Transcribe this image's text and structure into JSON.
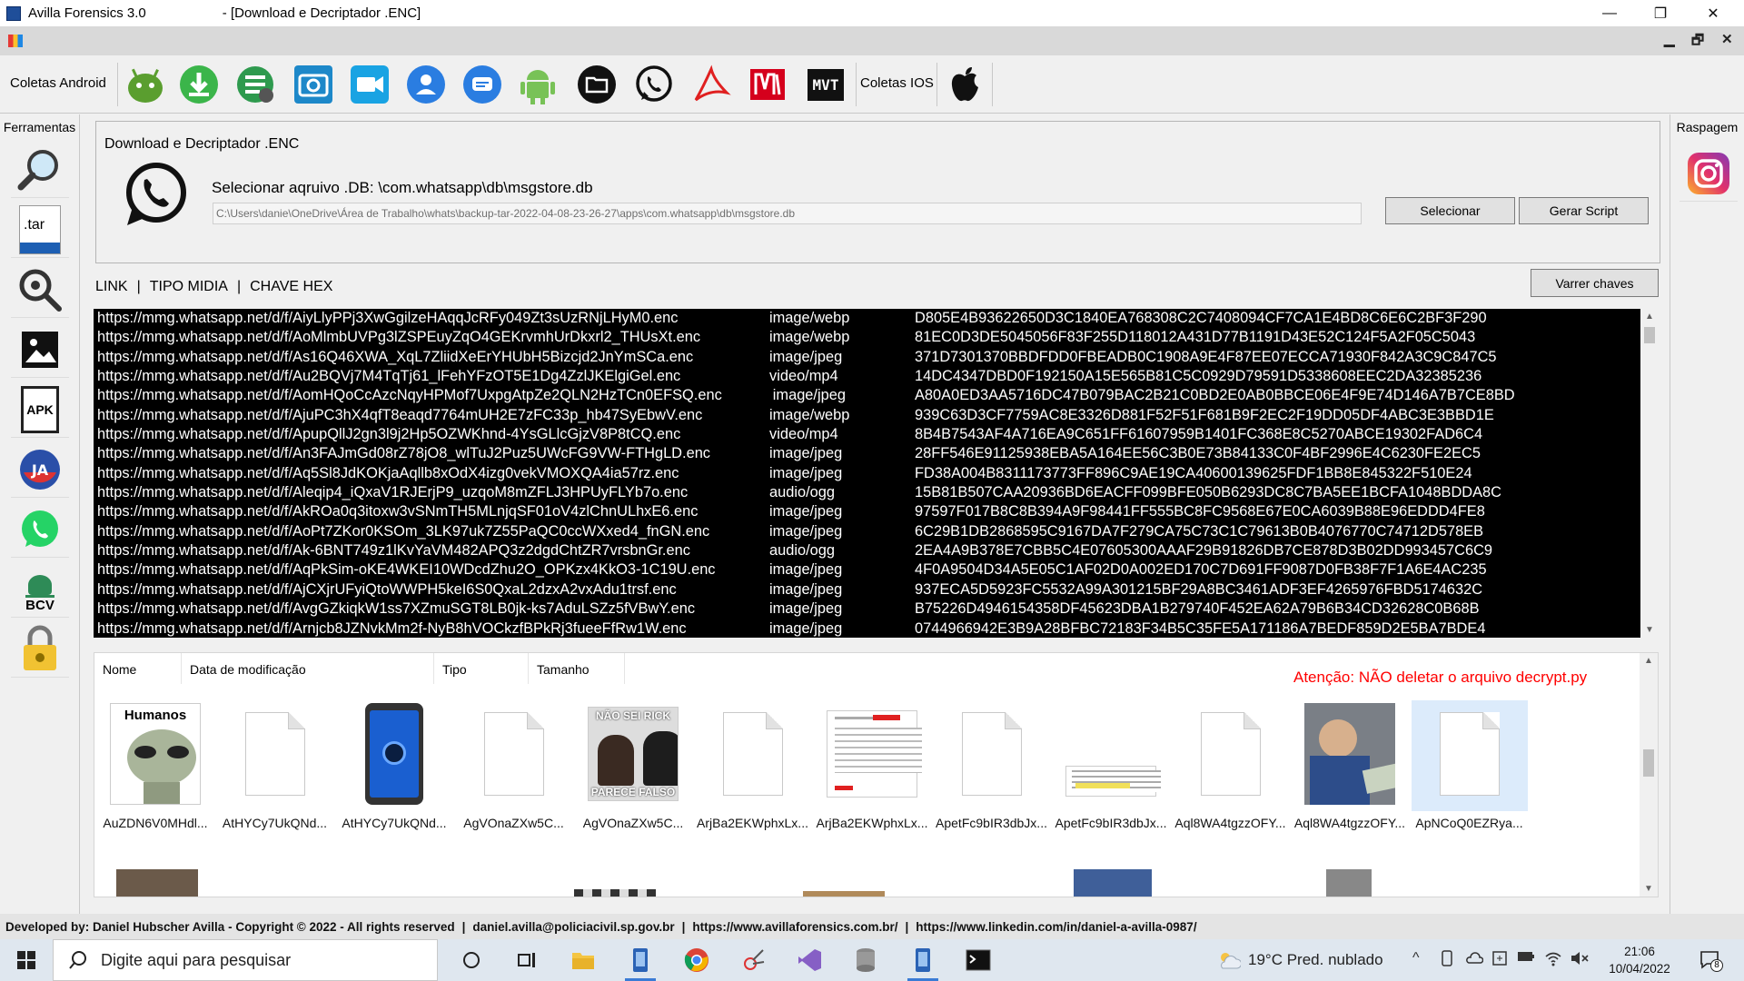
{
  "window": {
    "app_name": "Avilla Forensics 3.0",
    "doc_name": "- [Download e Decriptador .ENC]",
    "minimize_label": "—",
    "restore_label": "❐",
    "close_label": "✕",
    "mdi_minimize_label": "▁",
    "mdi_restore_label": "🗗",
    "mdi_close_label": "✕"
  },
  "toolbar": {
    "android_label": "Coletas Android",
    "ios_label": "Coletas IOS",
    "android_icons": [
      "android-head-icon",
      "download-icon",
      "sms-backup-icon",
      "camera-icon",
      "video-icon",
      "contacts-icon",
      "messages-icon",
      "android-robot-icon",
      "folder-black-icon",
      "whatsapp-icon",
      "pdf-icon",
      "m-logo-icon",
      "mvt-icon"
    ],
    "mvt_text": "MVT"
  },
  "sidebar_left": {
    "title": "Ferramentas",
    "tar_text": ".tar",
    "apk_text": "APK",
    "bcv_text": "BCV",
    "icons": [
      "magnifier-icon",
      "tar-file-icon",
      "gear-search-icon",
      "image-icon",
      "apk-icon",
      "jadx-icon",
      "whatsapp-icon",
      "bcv-icon",
      "hash-lock-icon"
    ]
  },
  "sidebar_right": {
    "title": "Raspagem",
    "icons": [
      "instagram-icon"
    ]
  },
  "panel": {
    "title": "Download e Decriptador .ENC",
    "db_label": "Selecionar aqruivo .DB: \\com.whatsapp\\db\\msgstore.db",
    "db_path": "C:\\Users\\danie\\OneDrive\\Área de Trabalho\\whats\\backup-tar-2022-04-08-23-26-27\\apps\\com.whatsapp\\db\\msgstore.db",
    "select_button": "Selecionar",
    "script_button": "Gerar Script",
    "keys_button": "Varrer chaves"
  },
  "columns": {
    "link": "LINK",
    "sep1": "|",
    "tipo": "TIPO MIDIA",
    "sep2": "|",
    "chave": "CHAVE HEX"
  },
  "terminal": {
    "rows": [
      {
        "url": "https://mmg.whatsapp.net/d/f/AiyLlyPPj3XwGgilzeHAqqJcRFy049Zt3sUzRNjLHyM0.enc",
        "type": "image/webp",
        "key": "D805E4B93622650D3C1840EA768308C2C7408094CF7CA1E4BD8C6E6C2BF3F290"
      },
      {
        "url": "https://mmg.whatsapp.net/d/f/AoMlmbUVPg3lZSPEuyZqO4GEKrvmhUrDkxrl2_THUsXt.enc",
        "type": "image/webp",
        "key": "81EC0D3DE5045056F83F255D118012A431D77B1191D43E52C124F5A2F05C5043"
      },
      {
        "url": "https://mmg.whatsapp.net/d/f/As16Q46XWA_XqL7ZliidXeErYHUbH5Bizcjd2JnYmSCa.enc",
        "type": "image/jpeg",
        "key": "371D7301370BBDFDD0FBEADB0C1908A9E4F87EE07ECCA71930F842A3C9C847C5"
      },
      {
        "url": "https://mmg.whatsapp.net/d/f/Au2BQVj7M4TqTj61_lFehYFzOT5E1Dg4ZzlJKElgiGel.enc",
        "type": "video/mp4",
        "key": "14DC4347DBD0F192150A15E565B81C5C0929D79591D5338608EEC2DA32385236"
      },
      {
        "url": "https://mmg.whatsapp.net/d/f/AomHQoCcAzcNqyHPMof7UxpgAtpZe2QLN2HzTCn0EFSQ.enc",
        "type": "image/jpeg",
        "key": "A80A0ED3AA5716DC47B079BAC2B21C0BD2E0AB0BBCE06E4F9E74D146A7B7CE8BD"
      },
      {
        "url": "https://mmg.whatsapp.net/d/f/AjuPC3hX4qfT8eaqd7764mUH2E7zFC33p_hb47SyEbwV.enc",
        "type": "image/webp",
        "key": "939C63D3CF7759AC8E3326D881F52F51F681B9F2EC2F19DD05DF4ABC3E3BBD1E"
      },
      {
        "url": "https://mmg.whatsapp.net/d/f/ApupQllJ2gn3l9j2Hp5OZWKhnd-4YsGLlcGjzV8P8tCQ.enc",
        "type": "video/mp4",
        "key": "8B4B7543AF4A716EA9C651FF61607959B1401FC368E8C5270ABCE19302FAD6C4"
      },
      {
        "url": "https://mmg.whatsapp.net/d/f/An3FAJmGd08rZ78jO8_wlTuJ2Puz5UWcFG9VW-FTHgLD.enc",
        "type": "image/jpeg",
        "key": "28FF546E91125938EBA5A164EE56C3B0E73B84133C0F4BF2996E4C6230FE2EC5"
      },
      {
        "url": "https://mmg.whatsapp.net/d/f/Aq5Sl8JdKOKjaAqllb8xOdX4izg0vekVMOXQA4ia57rz.enc",
        "type": "image/jpeg",
        "key": "FD38A004B8311173773FF896C9AE19CA40600139625FDF1BB8E845322F510E24"
      },
      {
        "url": "https://mmg.whatsapp.net/d/f/Aleqip4_iQxaV1RJErjP9_uzqoM8mZFLJ3HPUyFLYb7o.enc",
        "type": "audio/ogg",
        "key": "15B81B507CAA20936BD6EACFF099BFE050B6293DC8C7BA5EE1BCFA1048BDDA8C"
      },
      {
        "url": "https://mmg.whatsapp.net/d/f/AkROa0q3itoxw3vSNmTH5MLnjqSF01oV4zlChnULhxE6.enc",
        "type": "image/jpeg",
        "key": "97597F017B8C8B394A9F98441FF555BC8FC9568E67E0CA6039B88E96EDDD4FE8"
      },
      {
        "url": "https://mmg.whatsapp.net/d/f/AoPt7ZKor0KSOm_3LK97uk7Z55PaQC0ccWXxed4_fnGN.enc",
        "type": "image/jpeg",
        "key": "6C29B1DB2868595C9167DA7F279CA75C73C1C79613B0B4076770C74712D578EB"
      },
      {
        "url": "https://mmg.whatsapp.net/d/f/Ak-6BNT749z1lKvYaVM482APQ3z2dgdChtZR7vrsbnGr.enc",
        "type": "audio/ogg",
        "key": "2EA4A9B378E7CBB5C4E07605300AAAF29B91826DB7CE878D3B02DD993457C6C9"
      },
      {
        "url": "https://mmg.whatsapp.net/d/f/AqPkSim-oKE4WKEI10WDcdZhu2O_OPKzx4KkO3-1C19U.enc",
        "type": "image/jpeg",
        "key": "4F0A9504D34A5E05C1AF02D0A002ED170C7D691FF9087D0FB38F7F1A6E4AC235"
      },
      {
        "url": "https://mmg.whatsapp.net/d/f/AjCXjrUFyiQtoWWPH5keI6S0QxaL2dzxA2vxAdu1trsf.enc",
        "type": "image/jpeg",
        "key": "937ECA5D5923FC5532A99A301215BF29A8BC3461ADF3EF4265976FBD5174632C"
      },
      {
        "url": "https://mmg.whatsapp.net/d/f/AvgGZkiqkW1ss7XZmuSGT8LB0jk-ks7AduLSZz5fVBwY.enc",
        "type": "image/jpeg",
        "key": "B75226D4946154358DF45623DBA1B279740F452EA62A79B6B34CD32628C0B68B"
      },
      {
        "url": "https://mmg.whatsapp.net/d/f/Arnjcb8JZNvkMm2f-NyB8hVOCkzfBPkRj3fueeFfRw1W.enc",
        "type": "image/jpeg",
        "key": "0744966942E3B9A28BFBC72183F34B5C35FE5A171186A7BEDF859D2E5BA7BDE4"
      }
    ]
  },
  "explorer": {
    "headers": [
      "Nome",
      "Data de modificação",
      "Tipo",
      "Tamanho"
    ],
    "warning": "Atenção: NÃO deletar o arquivo decrypt.py",
    "files": [
      {
        "name": "AuZDN6V0MHdl...",
        "kind": "alien"
      },
      {
        "name": "AtHYCy7UkQNd...",
        "kind": "blank"
      },
      {
        "name": "AtHYCy7UkQNd...",
        "kind": "phone"
      },
      {
        "name": "AgVOnaZXw5C...",
        "kind": "blank"
      },
      {
        "name": "AgVOnaZXw5C...",
        "kind": "meme"
      },
      {
        "name": "ArjBa2EKWphxLx...",
        "kind": "blank"
      },
      {
        "name": "ArjBa2EKWphxLx...",
        "kind": "document"
      },
      {
        "name": "ApetFc9bIR3dbJx...",
        "kind": "blank"
      },
      {
        "name": "ApetFc9bIR3dbJx...",
        "kind": "doc-strip"
      },
      {
        "name": "Aql8WA4tgzzOFY...",
        "kind": "blank"
      },
      {
        "name": "Aql8WA4tgzzOFY...",
        "kind": "photo"
      },
      {
        "name": "ApNCoQ0EZRya...",
        "kind": "blank"
      }
    ],
    "alien_text": "Humanos",
    "meme_top": "NÃO SEI RICK",
    "meme_bottom": "PARECE FALSO"
  },
  "footer": {
    "credit": "Developed by: Daniel Hubscher Avilla - Copyright © 2022 - All rights reserved",
    "email": "daniel.avilla@policiacivil.sp.gov.br",
    "site": "https://www.avillaforensics.com.br/",
    "linkedin": "https://www.linkedin.com/in/daniel-a-avilla-0987/",
    "sep": "|"
  },
  "taskbar": {
    "search_placeholder": "Digite aqui para pesquisar",
    "weather": "19°C  Pred. nublado",
    "time": "21:06",
    "date": "10/04/2022",
    "notif_count": "8"
  }
}
